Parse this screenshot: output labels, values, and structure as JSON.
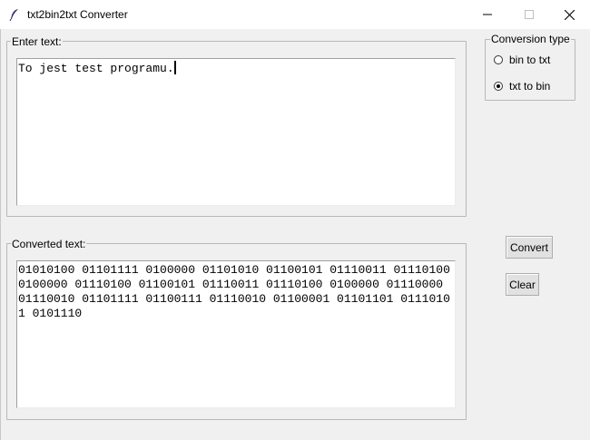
{
  "window": {
    "title": "txt2bin2txt Converter"
  },
  "input_frame": {
    "legend": "Enter text:",
    "value": "To jest test programu."
  },
  "output_frame": {
    "legend": "Converted text:",
    "value": "01010100 01101111 0100000 01101010 01100101 01110011 01110100 0100000 01110100 01100101 01110011 01110100 0100000 01110000 01110010 01101111 01100111 01110010 01100001 01101101 01110101 0101110"
  },
  "conversion": {
    "legend": "Conversion type",
    "options": [
      {
        "label": "bin to txt",
        "selected": false
      },
      {
        "label": "txt to bin",
        "selected": true
      }
    ]
  },
  "buttons": {
    "convert": "Convert",
    "clear": "Clear"
  }
}
